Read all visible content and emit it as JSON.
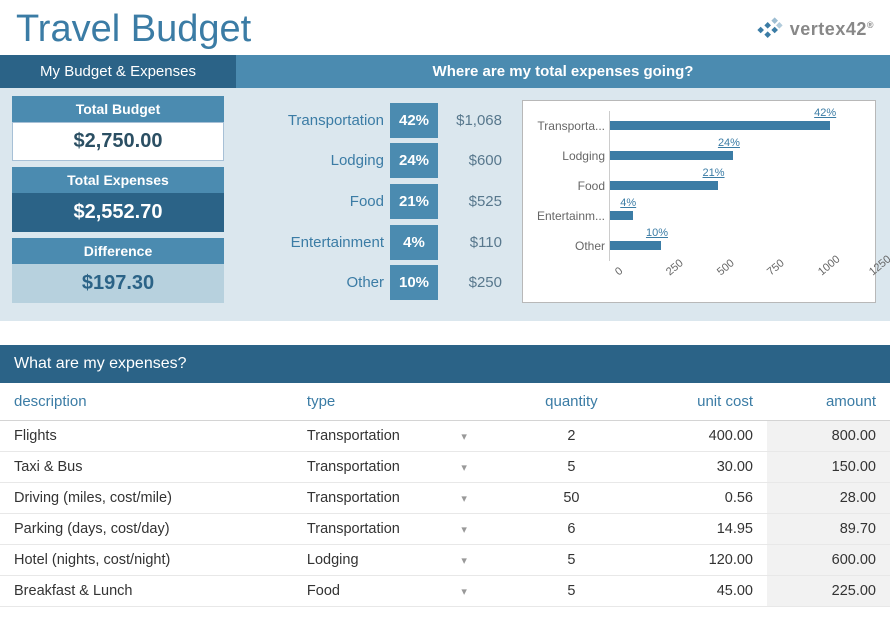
{
  "title": "Travel Budget",
  "logo_text": "vertex42",
  "headers": {
    "my_budget": "My Budget & Expenses",
    "where": "Where are my total expenses going?"
  },
  "summary": {
    "total_budget_label": "Total Budget",
    "total_budget": "$2,750.00",
    "total_expenses_label": "Total Expenses",
    "total_expenses": "$2,552.70",
    "difference_label": "Difference",
    "difference": "$197.30"
  },
  "breakdown": [
    {
      "label": "Transportation",
      "pct": "42%",
      "amount": "$1,068"
    },
    {
      "label": "Lodging",
      "pct": "24%",
      "amount": "$600"
    },
    {
      "label": "Food",
      "pct": "21%",
      "amount": "$525"
    },
    {
      "label": "Entertainment",
      "pct": "4%",
      "amount": "$110"
    },
    {
      "label": "Other",
      "pct": "10%",
      "amount": "$250"
    }
  ],
  "chart_data": {
    "type": "bar",
    "orientation": "horizontal",
    "categories": [
      "Transporta...",
      "Lodging",
      "Food",
      "Entertainm...",
      "Other"
    ],
    "values": [
      1068,
      600,
      525,
      110,
      250
    ],
    "bar_labels": [
      "42%",
      "24%",
      "21%",
      "4%",
      "10%"
    ],
    "xticks": [
      0,
      250,
      500,
      750,
      1000,
      1250
    ],
    "xlim": [
      0,
      1250
    ],
    "title": "",
    "xlabel": "",
    "ylabel": ""
  },
  "expenses_header": "What are my expenses?",
  "expense_columns": {
    "description": "description",
    "type": "type",
    "quantity": "quantity",
    "unit_cost": "unit cost",
    "amount": "amount"
  },
  "expenses": [
    {
      "description": "Flights",
      "type": "Transportation",
      "quantity": "2",
      "unit_cost": "400.00",
      "amount": "800.00"
    },
    {
      "description": "Taxi & Bus",
      "type": "Transportation",
      "quantity": "5",
      "unit_cost": "30.00",
      "amount": "150.00"
    },
    {
      "description": "Driving (miles, cost/mile)",
      "type": "Transportation",
      "quantity": "50",
      "unit_cost": "0.56",
      "amount": "28.00"
    },
    {
      "description": "Parking (days, cost/day)",
      "type": "Transportation",
      "quantity": "6",
      "unit_cost": "14.95",
      "amount": "89.70"
    },
    {
      "description": "Hotel (nights, cost/night)",
      "type": "Lodging",
      "quantity": "5",
      "unit_cost": "120.00",
      "amount": "600.00"
    },
    {
      "description": "Breakfast & Lunch",
      "type": "Food",
      "quantity": "5",
      "unit_cost": "45.00",
      "amount": "225.00"
    }
  ]
}
